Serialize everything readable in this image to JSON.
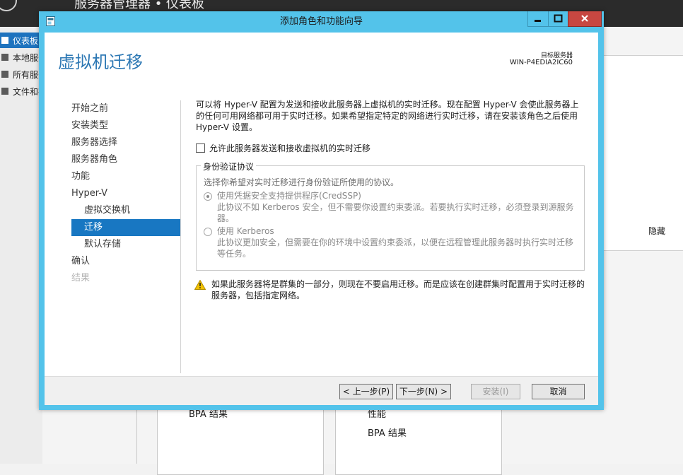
{
  "background": {
    "title": "服务器管理器 • 仪表板",
    "nav": [
      {
        "label": "仪表板",
        "active": true
      },
      {
        "label": "本地服务器"
      },
      {
        "label": "所有服务器"
      },
      {
        "label": "文件和存储服务"
      }
    ],
    "hide_label": "隐藏",
    "card1_text": "BPA 结果",
    "card2_perf": "性能",
    "card2_bpa": "BPA 结果"
  },
  "dialog": {
    "title": "添加角色和功能向导",
    "page_title": "虚拟机迁移",
    "target_label": "目标服务器",
    "target_value": "WIN-P4EDIA2IC60",
    "nav": [
      {
        "label": "开始之前",
        "state": "normal",
        "level": 0
      },
      {
        "label": "安装类型",
        "state": "normal",
        "level": 0
      },
      {
        "label": "服务器选择",
        "state": "normal",
        "level": 0
      },
      {
        "label": "服务器角色",
        "state": "normal",
        "level": 0
      },
      {
        "label": "功能",
        "state": "normal",
        "level": 0
      },
      {
        "label": "Hyper-V",
        "state": "normal",
        "level": 0
      },
      {
        "label": "虚拟交换机",
        "state": "normal",
        "level": 1
      },
      {
        "label": "迁移",
        "state": "active",
        "level": 1
      },
      {
        "label": "默认存储",
        "state": "normal",
        "level": 1
      },
      {
        "label": "确认",
        "state": "normal",
        "level": 0
      },
      {
        "label": "结果",
        "state": "disabled",
        "level": 0
      }
    ],
    "description": "可以将 Hyper-V 配置为发送和接收此服务器上虚拟机的实时迁移。现在配置 Hyper-V 会使此服务器上的任何可用网络都可用于实时迁移。如果希望指定特定的网络进行实时迁移，请在安装该角色之后使用 Hyper-V 设置。",
    "checkbox_label": "允许此服务器发送和接收虚拟机的实时迁移",
    "checkbox_checked": false,
    "auth_group": {
      "legend": "身份验证协议",
      "intro": "选择你希望对实时迁移进行身份验证所使用的协议。",
      "options": [
        {
          "label": "使用凭据安全支持提供程序(CredSSP)",
          "desc": "此协议不如 Kerberos 安全，但不需要你设置约束委派。若要执行实时迁移，必须登录到源服务器。",
          "selected": true
        },
        {
          "label": "使用 Kerberos",
          "desc": "此协议更加安全，但需要在你的环境中设置约束委派，以便在远程管理此服务器时执行实时迁移等任务。",
          "selected": false
        }
      ]
    },
    "warning": "如果此服务器将是群集的一部分，则现在不要启用迁移。而是应该在创建群集时配置用于实时迁移的服务器，包括指定网络。",
    "buttons": {
      "prev": "< 上一步(P)",
      "next": "下一步(N) >",
      "install": "安装(I)",
      "cancel": "取消"
    }
  },
  "colors": {
    "accent": "#1877c2",
    "title_bar": "#53c3ea",
    "close_button": "#c74741",
    "page_title": "#2d78b4"
  }
}
